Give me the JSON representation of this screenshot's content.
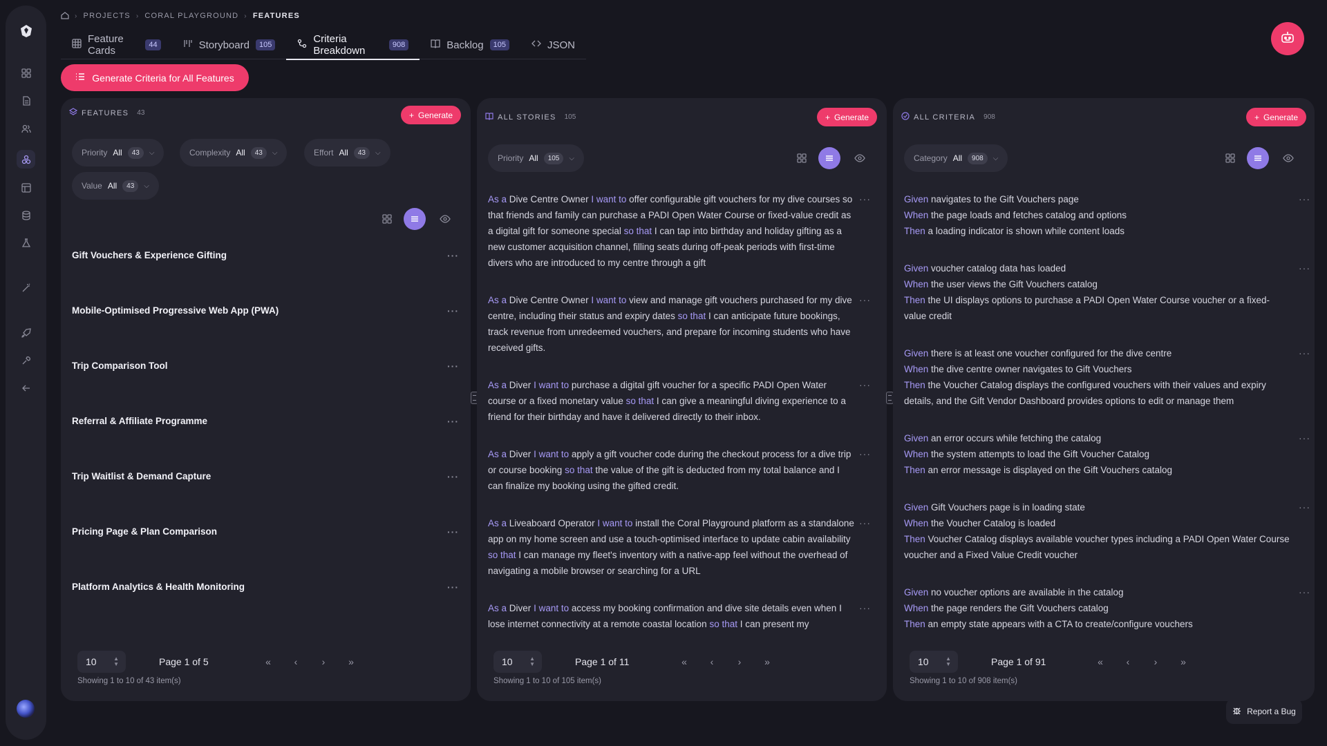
{
  "breadcrumb": {
    "projects": "PROJECTS",
    "project": "CORAL PLAYGROUND",
    "current": "FEATURES"
  },
  "tabs": [
    {
      "label": "Feature Cards",
      "count": "44"
    },
    {
      "label": "Storyboard",
      "count": "105"
    },
    {
      "label": "Criteria Breakdown",
      "count": "908"
    },
    {
      "label": "Backlog",
      "count": "105"
    },
    {
      "label": "JSON",
      "count": ""
    }
  ],
  "generate_all_label": "Generate Criteria for All Features",
  "features": {
    "title": "FEATURES",
    "count": "43",
    "generate_label": "Generate",
    "filters": [
      {
        "label": "Priority",
        "value": "All",
        "count": "43"
      },
      {
        "label": "Complexity",
        "value": "All",
        "count": "43"
      },
      {
        "label": "Effort",
        "value": "All",
        "count": "43"
      },
      {
        "label": "Value",
        "value": "All",
        "count": "43"
      }
    ],
    "items": [
      "Gift Vouchers & Experience Gifting",
      "Mobile-Optimised Progressive Web App (PWA)",
      "Trip Comparison Tool",
      "Referral & Affiliate Programme",
      "Trip Waitlist & Demand Capture",
      "Pricing Page & Plan Comparison",
      "Platform Analytics & Health Monitoring"
    ],
    "page_size": "10",
    "page_label": "Page 1 of 5",
    "showing": "Showing 1 to 10 of 43 item(s)"
  },
  "stories": {
    "title": "ALL STORIES",
    "count": "105",
    "generate_label": "Generate",
    "filter": {
      "label": "Priority",
      "value": "All",
      "count": "105"
    },
    "kw": {
      "as_a": "As a",
      "i_want": "I want to",
      "so_that": "so that"
    },
    "items": [
      {
        "role": "Dive Centre Owner",
        "want": "offer configurable gift vouchers for my dive courses so that friends and family can purchase a PADI Open Water Course or fixed-value credit as a digital gift for someone special",
        "benefit": "I can tap into birthday and holiday gifting as a new customer acquisition channel, filling seats during off-peak periods with first-time divers who are introduced to my centre through a gift"
      },
      {
        "role": "Dive Centre Owner",
        "want": "view and manage gift vouchers purchased for my dive centre, including their status and expiry dates",
        "benefit": "I can anticipate future bookings, track revenue from unredeemed vouchers, and prepare for incoming students who have received gifts."
      },
      {
        "role": "Diver",
        "want": "purchase a digital gift voucher for a specific PADI Open Water course or a fixed monetary value",
        "benefit": "I can give a meaningful diving experience to a friend for their birthday and have it delivered directly to their inbox."
      },
      {
        "role": "Diver",
        "want": "apply a gift voucher code during the checkout process for a dive trip or course booking",
        "benefit": "the value of the gift is deducted from my total balance and I can finalize my booking using the gifted credit."
      },
      {
        "role": "Liveaboard Operator",
        "want": "install the Coral Playground platform as a standalone app on my home screen and use a touch-optimised interface to update cabin availability",
        "benefit": "I can manage my fleet's inventory with a native-app feel without the overhead of navigating a mobile browser or searching for a URL"
      },
      {
        "role": "Diver",
        "want": "access my booking confirmation and dive site details even when I lose internet connectivity at a remote coastal location",
        "benefit": "I can present my"
      }
    ],
    "page_size": "10",
    "page_label": "Page 1 of 11",
    "showing": "Showing 1 to 10 of 105 item(s)"
  },
  "criteria": {
    "title": "ALL CRITERIA",
    "count": "908",
    "generate_label": "Generate",
    "filter": {
      "label": "Category",
      "value": "All",
      "count": "908"
    },
    "kw": {
      "given": "Given",
      "when": "When",
      "then": "Then"
    },
    "items": [
      {
        "given": "navigates to the Gift Vouchers page",
        "when": "the page loads and fetches catalog and options",
        "then": "a loading indicator is shown while content loads"
      },
      {
        "given": "voucher catalog data has loaded",
        "when": "the user views the Gift Vouchers catalog",
        "then": "the UI displays options to purchase a PADI Open Water Course voucher or a fixed-value credit"
      },
      {
        "given": "there is at least one voucher configured for the dive centre",
        "when": "the dive centre owner navigates to Gift Vouchers",
        "then": "the Voucher Catalog displays the configured vouchers with their values and expiry details, and the Gift Vendor Dashboard provides options to edit or manage them"
      },
      {
        "given": "an error occurs while fetching the catalog",
        "when": "the system attempts to load the Gift Voucher Catalog",
        "then": "an error message is displayed on the Gift Vouchers catalog"
      },
      {
        "given": "Gift Vouchers page is in loading state",
        "when": "the Voucher Catalog is loaded",
        "then": "Voucher Catalog displays available voucher types including a PADI Open Water Course voucher and a Fixed Value Credit voucher"
      },
      {
        "given": "no voucher options are available in the catalog",
        "when": "the page renders the Gift Vouchers catalog",
        "then": "an empty state appears with a CTA to create/configure vouchers"
      }
    ],
    "page_size": "10",
    "page_label": "Page 1 of 91",
    "showing": "Showing 1 to 10 of 908 item(s)"
  },
  "report_bug_label": "Report a Bug",
  "colors": {
    "accent": "#ee3b6b",
    "keyword": "#a79af6",
    "toggle": "#8f7ae6"
  }
}
